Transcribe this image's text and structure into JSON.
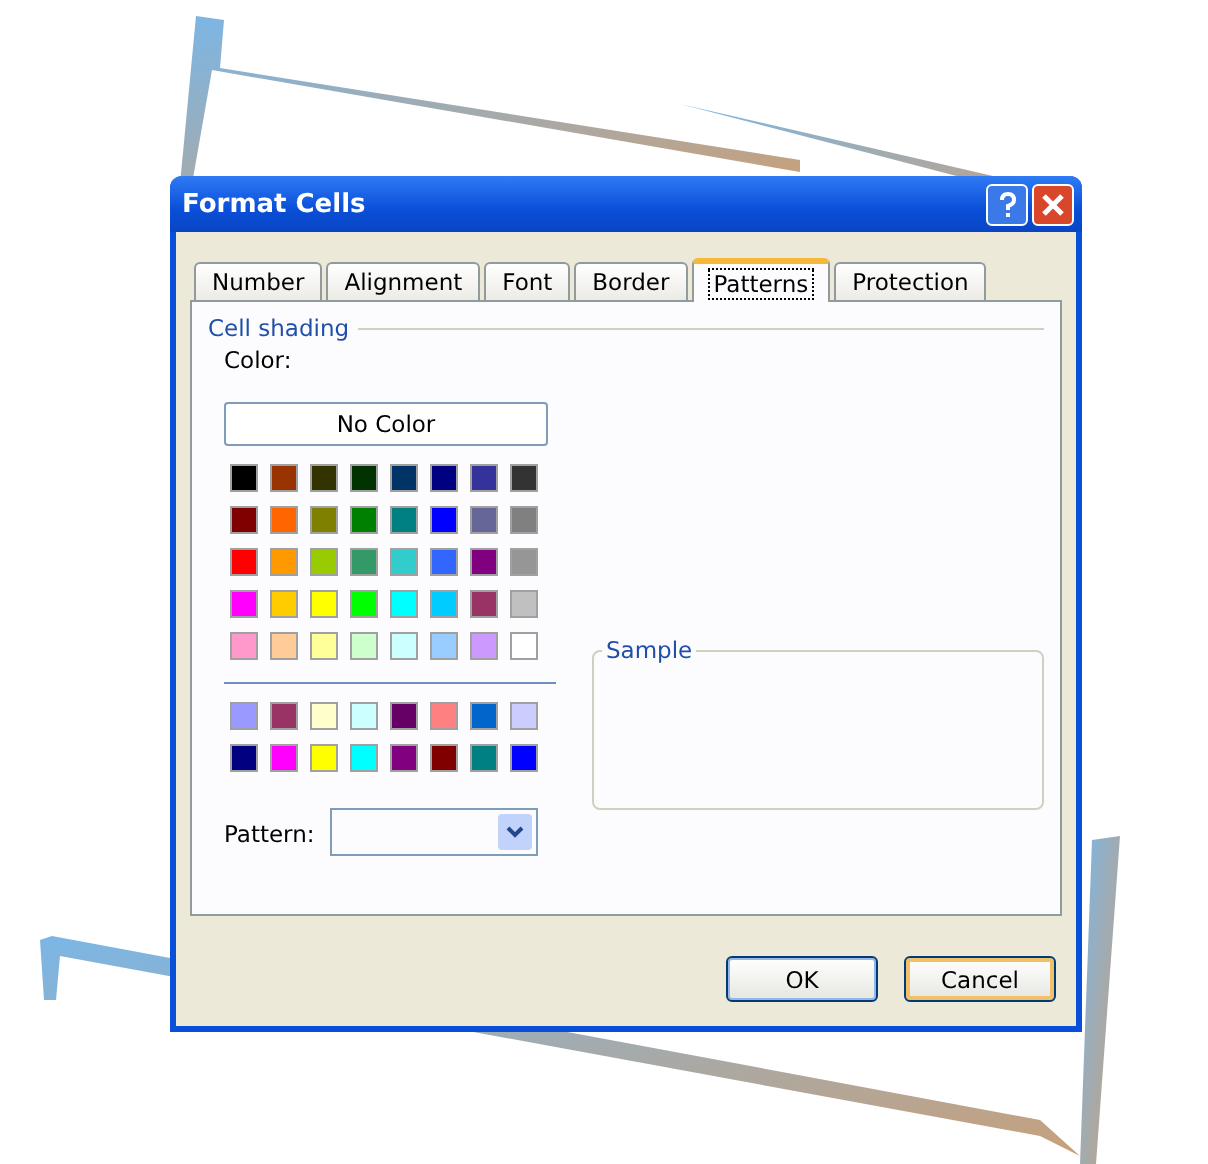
{
  "window": {
    "title": "Format Cells"
  },
  "tabs": [
    {
      "label": "Number",
      "selected": false
    },
    {
      "label": "Alignment",
      "selected": false
    },
    {
      "label": "Font",
      "selected": false
    },
    {
      "label": "Border",
      "selected": false
    },
    {
      "label": "Patterns",
      "selected": true
    },
    {
      "label": "Protection",
      "selected": false
    }
  ],
  "cell_shading": {
    "title": "Cell shading",
    "color_label": "Color:",
    "no_color_button": "No Color",
    "palette": [
      {
        "color": "#000000"
      },
      {
        "color": "#993300"
      },
      {
        "color": "#333300"
      },
      {
        "color": "#003300"
      },
      {
        "color": "#003366"
      },
      {
        "color": "#000080"
      },
      {
        "color": "#333399"
      },
      {
        "color": "#333333"
      },
      {
        "color": "#800000"
      },
      {
        "color": "#ff6600"
      },
      {
        "color": "#808000"
      },
      {
        "color": "#008000"
      },
      {
        "color": "#008080"
      },
      {
        "color": "#0000ff"
      },
      {
        "color": "#666699"
      },
      {
        "color": "#808080"
      },
      {
        "color": "#ff0000"
      },
      {
        "color": "#ff9900"
      },
      {
        "color": "#99cc00"
      },
      {
        "color": "#339966"
      },
      {
        "color": "#33cccc"
      },
      {
        "color": "#3366ff"
      },
      {
        "color": "#800080"
      },
      {
        "color": "#969696"
      },
      {
        "color": "#ff00ff"
      },
      {
        "color": "#ffcc00"
      },
      {
        "color": "#ffff00"
      },
      {
        "color": "#00ff00"
      },
      {
        "color": "#00ffff"
      },
      {
        "color": "#00ccff"
      },
      {
        "color": "#993366"
      },
      {
        "color": "#c0c0c0"
      },
      {
        "color": "#ff99cc"
      },
      {
        "color": "#ffcc99"
      },
      {
        "color": "#ffff99"
      },
      {
        "color": "#ccffcc"
      },
      {
        "color": "#ccffff"
      },
      {
        "color": "#99ccff"
      },
      {
        "color": "#cc99ff"
      },
      {
        "color": "#ffffff"
      }
    ],
    "chart_colors": [
      {
        "color": "#9999ff"
      },
      {
        "color": "#993366"
      },
      {
        "color": "#ffffcc"
      },
      {
        "color": "#ccffff"
      },
      {
        "color": "#660066"
      },
      {
        "color": "#ff8080"
      },
      {
        "color": "#0066cc"
      },
      {
        "color": "#ccccff"
      },
      {
        "color": "#000080"
      },
      {
        "color": "#ff00ff"
      },
      {
        "color": "#ffff00"
      },
      {
        "color": "#00ffff"
      },
      {
        "color": "#800080"
      },
      {
        "color": "#800000"
      },
      {
        "color": "#008080"
      },
      {
        "color": "#0000ff"
      }
    ],
    "pattern_label": "Pattern:"
  },
  "sample": {
    "title": "Sample"
  },
  "buttons": [
    {
      "label": "OK",
      "kind": "default"
    },
    {
      "label": "Cancel",
      "kind": "focused"
    }
  ]
}
